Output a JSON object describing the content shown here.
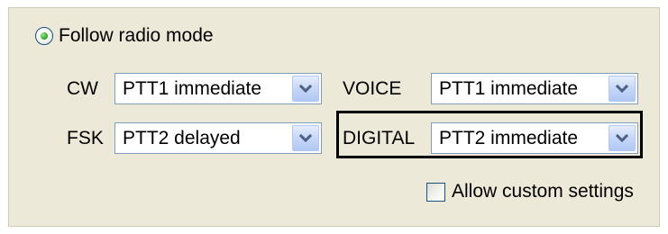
{
  "follow_radio_mode": {
    "label": "Follow radio mode",
    "selected": true
  },
  "rows": {
    "cw": {
      "label": "CW",
      "value": "PTT1 immediate"
    },
    "voice": {
      "label": "VOICE",
      "value": "PTT1 immediate"
    },
    "fsk": {
      "label": "FSK",
      "value": "PTT2 delayed"
    },
    "digital": {
      "label": "DIGITAL",
      "value": "PTT2 immediate"
    }
  },
  "allow_custom": {
    "label": "Allow custom settings",
    "checked": false
  },
  "icons": {
    "combo_arrow": "chevron-down-icon",
    "radio_dot": "radio-selected-dot"
  },
  "colors": {
    "panel_bg": "#ece9d8",
    "combo_border": "#7f9db9",
    "radio_green": "#38b12e",
    "arrow_blue": "#4d6185"
  }
}
